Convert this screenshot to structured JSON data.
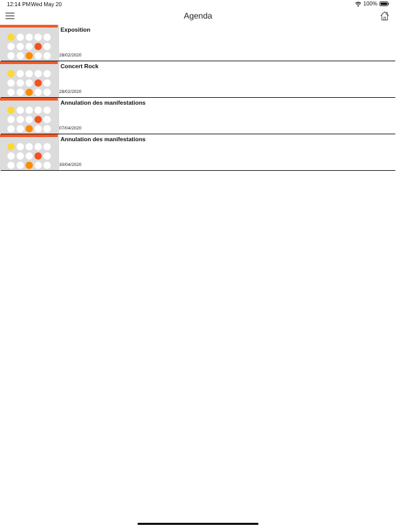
{
  "status_bar": {
    "time": "12:14 PM",
    "date": "Wed May 20",
    "battery": "100%",
    "wifi_icon": "wifi-icon",
    "battery_icon": "battery-icon"
  },
  "nav_bar": {
    "title": "Agenda",
    "menu_icon": "hamburger-menu-icon",
    "home_icon": "home-icon"
  },
  "colors": {
    "accent_bar": "#ef5a28",
    "dot_yellow": "#fdd835",
    "dot_red": "#f4511e",
    "dot_orange": "#fb8c00",
    "thumb_bg": "#dcdcdc"
  },
  "agenda": {
    "items": [
      {
        "title": "Exposition",
        "date": "28/02/2020"
      },
      {
        "title": "Concert Rock",
        "date": "28/02/2020"
      },
      {
        "title": "Annulation des manifestations",
        "date": "07/04/2020"
      },
      {
        "title": "Annulation des manifestations",
        "date": "30/04/2020"
      }
    ]
  }
}
